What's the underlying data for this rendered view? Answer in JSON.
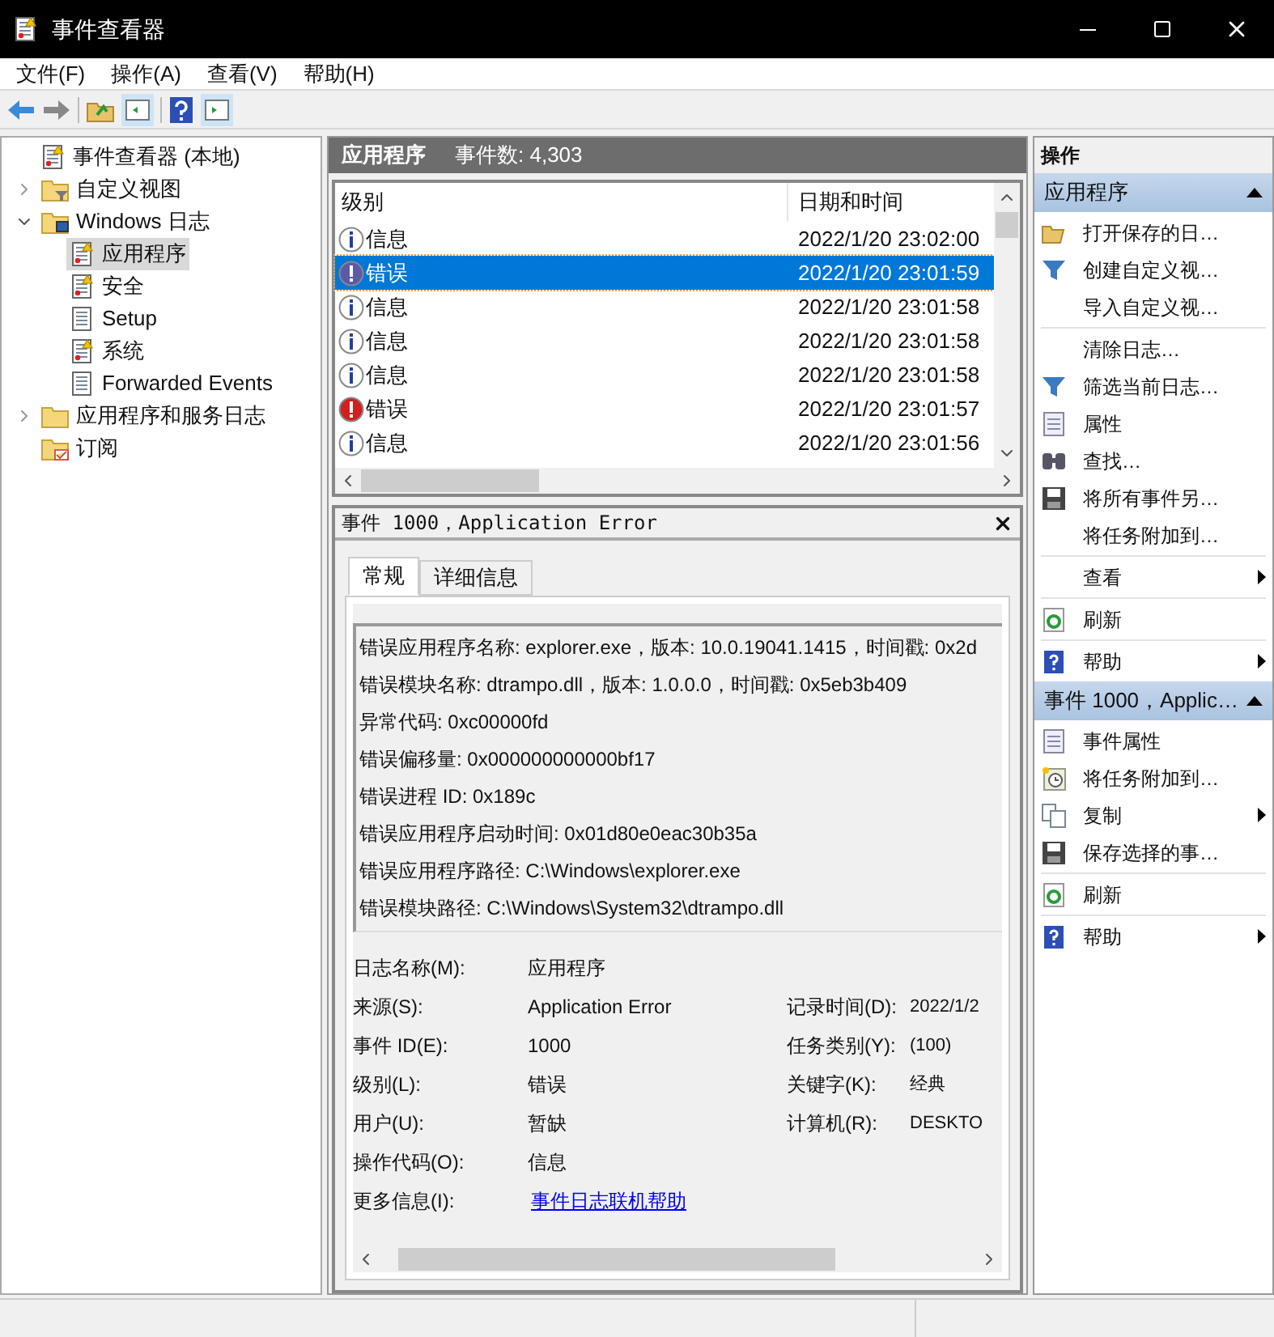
{
  "window": {
    "title": "事件查看器"
  },
  "menu": [
    "文件(F)",
    "操作(A)",
    "查看(V)",
    "帮助(H)"
  ],
  "tree": [
    {
      "label": "事件查看器 (本地)",
      "kind": "root",
      "selected": false,
      "children": [
        {
          "label": "自定义视图",
          "kind": "filter",
          "selected": false,
          "expanded": false
        },
        {
          "label": "Windows 日志",
          "kind": "monitor",
          "selected": false,
          "expanded": true,
          "children": [
            {
              "label": "应用程序",
              "kind": "log",
              "selected": true
            },
            {
              "label": "安全",
              "kind": "log",
              "selected": false
            },
            {
              "label": "Setup",
              "kind": "list",
              "selected": false
            },
            {
              "label": "系统",
              "kind": "log",
              "selected": false
            },
            {
              "label": "Forwarded Events",
              "kind": "list",
              "selected": false
            }
          ]
        },
        {
          "label": "应用程序和服务日志",
          "kind": "folder",
          "selected": false,
          "expanded": false
        },
        {
          "label": "订阅",
          "kind": "subscription",
          "selected": false
        }
      ]
    }
  ],
  "list_header": {
    "title": "应用程序",
    "count": "事件数: 4,303"
  },
  "events": {
    "columns": [
      "级别",
      "日期和时间"
    ],
    "rows": [
      {
        "kind": "info",
        "level": "信息",
        "datetime": "2022/1/20 23:02:00",
        "selected": false
      },
      {
        "kind": "error",
        "level": "错误",
        "datetime": "2022/1/20 23:01:59",
        "selected": true
      },
      {
        "kind": "info",
        "level": "信息",
        "datetime": "2022/1/20 23:01:58",
        "selected": false
      },
      {
        "kind": "info",
        "level": "信息",
        "datetime": "2022/1/20 23:01:58",
        "selected": false
      },
      {
        "kind": "info",
        "level": "信息",
        "datetime": "2022/1/20 23:01:58",
        "selected": false
      },
      {
        "kind": "error",
        "level": "错误",
        "datetime": "2022/1/20 23:01:57",
        "selected": false
      },
      {
        "kind": "info",
        "level": "信息",
        "datetime": "2022/1/20 23:01:56",
        "selected": false
      }
    ]
  },
  "detail": {
    "title": "事件 1000，Application Error",
    "tabs": [
      {
        "label": "常规",
        "selected": true
      },
      {
        "label": "详细信息",
        "selected": false
      }
    ],
    "description": [
      "错误应用程序名称: explorer.exe，版本: 10.0.19041.1415，时间戳: 0x2d",
      "错误模块名称: dtrampo.dll，版本: 1.0.0.0，时间戳: 0x5eb3b409",
      "异常代码: 0xc00000fd",
      "错误偏移量: 0x000000000000bf17",
      "错误进程 ID: 0x189c",
      "错误应用程序启动时间: 0x01d80e0eac30b35a",
      "错误应用程序路径: C:\\Windows\\explorer.exe",
      "错误模块路径: C:\\Windows\\System32\\dtrampo.dll"
    ],
    "fields": [
      {
        "label": "日志名称(M):",
        "value": "应用程序"
      },
      {
        "label": "来源(S):",
        "value": "Application Error",
        "label2": "记录时间(D):",
        "value2": "2022/1/2"
      },
      {
        "label": "事件 ID(E):",
        "value": "1000",
        "label2": "任务类别(Y):",
        "value2": "(100)"
      },
      {
        "label": "级别(L):",
        "value": "错误",
        "label2": "关键字(K):",
        "value2": "经典"
      },
      {
        "label": "用户(U):",
        "value": "暂缺",
        "label2": "计算机(R):",
        "value2": "DESKTO"
      },
      {
        "label": "操作代码(O):",
        "value": "信息"
      },
      {
        "label": "更多信息(I):",
        "link": "事件日志联机帮助"
      }
    ]
  },
  "actions": {
    "title": "操作",
    "sections": [
      {
        "title": "应用程序",
        "expanded": true,
        "groups": [
          [
            {
              "label": "打开保存的日…",
              "submenu": false
            },
            {
              "label": "创建自定义视…",
              "submenu": false
            },
            {
              "label": "导入自定义视…",
              "submenu": false
            }
          ],
          [
            {
              "label": "清除日志…",
              "submenu": false
            },
            {
              "label": "筛选当前日志…",
              "submenu": false
            },
            {
              "label": "属性",
              "submenu": false
            },
            {
              "label": "查找…",
              "submenu": false
            },
            {
              "label": "将所有事件另…",
              "submenu": false
            },
            {
              "label": "将任务附加到…",
              "submenu": false
            }
          ],
          [
            {
              "label": "查看",
              "submenu": true
            }
          ],
          [
            {
              "label": "刷新",
              "submenu": false
            }
          ],
          [
            {
              "label": "帮助",
              "submenu": true
            }
          ]
        ]
      },
      {
        "title": "事件 1000，Applic…",
        "expanded": true,
        "groups": [
          [
            {
              "label": "事件属性",
              "submenu": false
            },
            {
              "label": "将任务附加到…",
              "submenu": false
            },
            {
              "label": "复制",
              "submenu": true
            },
            {
              "label": "保存选择的事…",
              "submenu": false
            }
          ],
          [
            {
              "label": "刷新",
              "submenu": false
            }
          ],
          [
            {
              "label": "帮助",
              "submenu": true
            }
          ]
        ]
      }
    ]
  }
}
